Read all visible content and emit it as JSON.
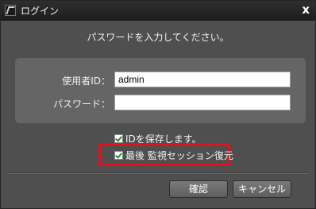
{
  "window": {
    "title": "ログイン",
    "close_symbol": "x",
    "app_icon": "app-logo-icon"
  },
  "prompt": "パスワードを入力してください。",
  "form": {
    "user_label": "使用者ID：",
    "user_value": "admin",
    "password_label": "パスワード：",
    "password_value": ""
  },
  "options": {
    "save_id_label": "IDを保存します。",
    "save_id_checked": true,
    "restore_session_label": "最後 監視セッション復元",
    "restore_session_checked": true
  },
  "buttons": {
    "ok_label": "確認",
    "cancel_label": "キャンセル"
  },
  "colors": {
    "highlight": "#e3111e",
    "check": "#1f8f2f",
    "panel": "#656565",
    "background": "#4f4f4f"
  }
}
